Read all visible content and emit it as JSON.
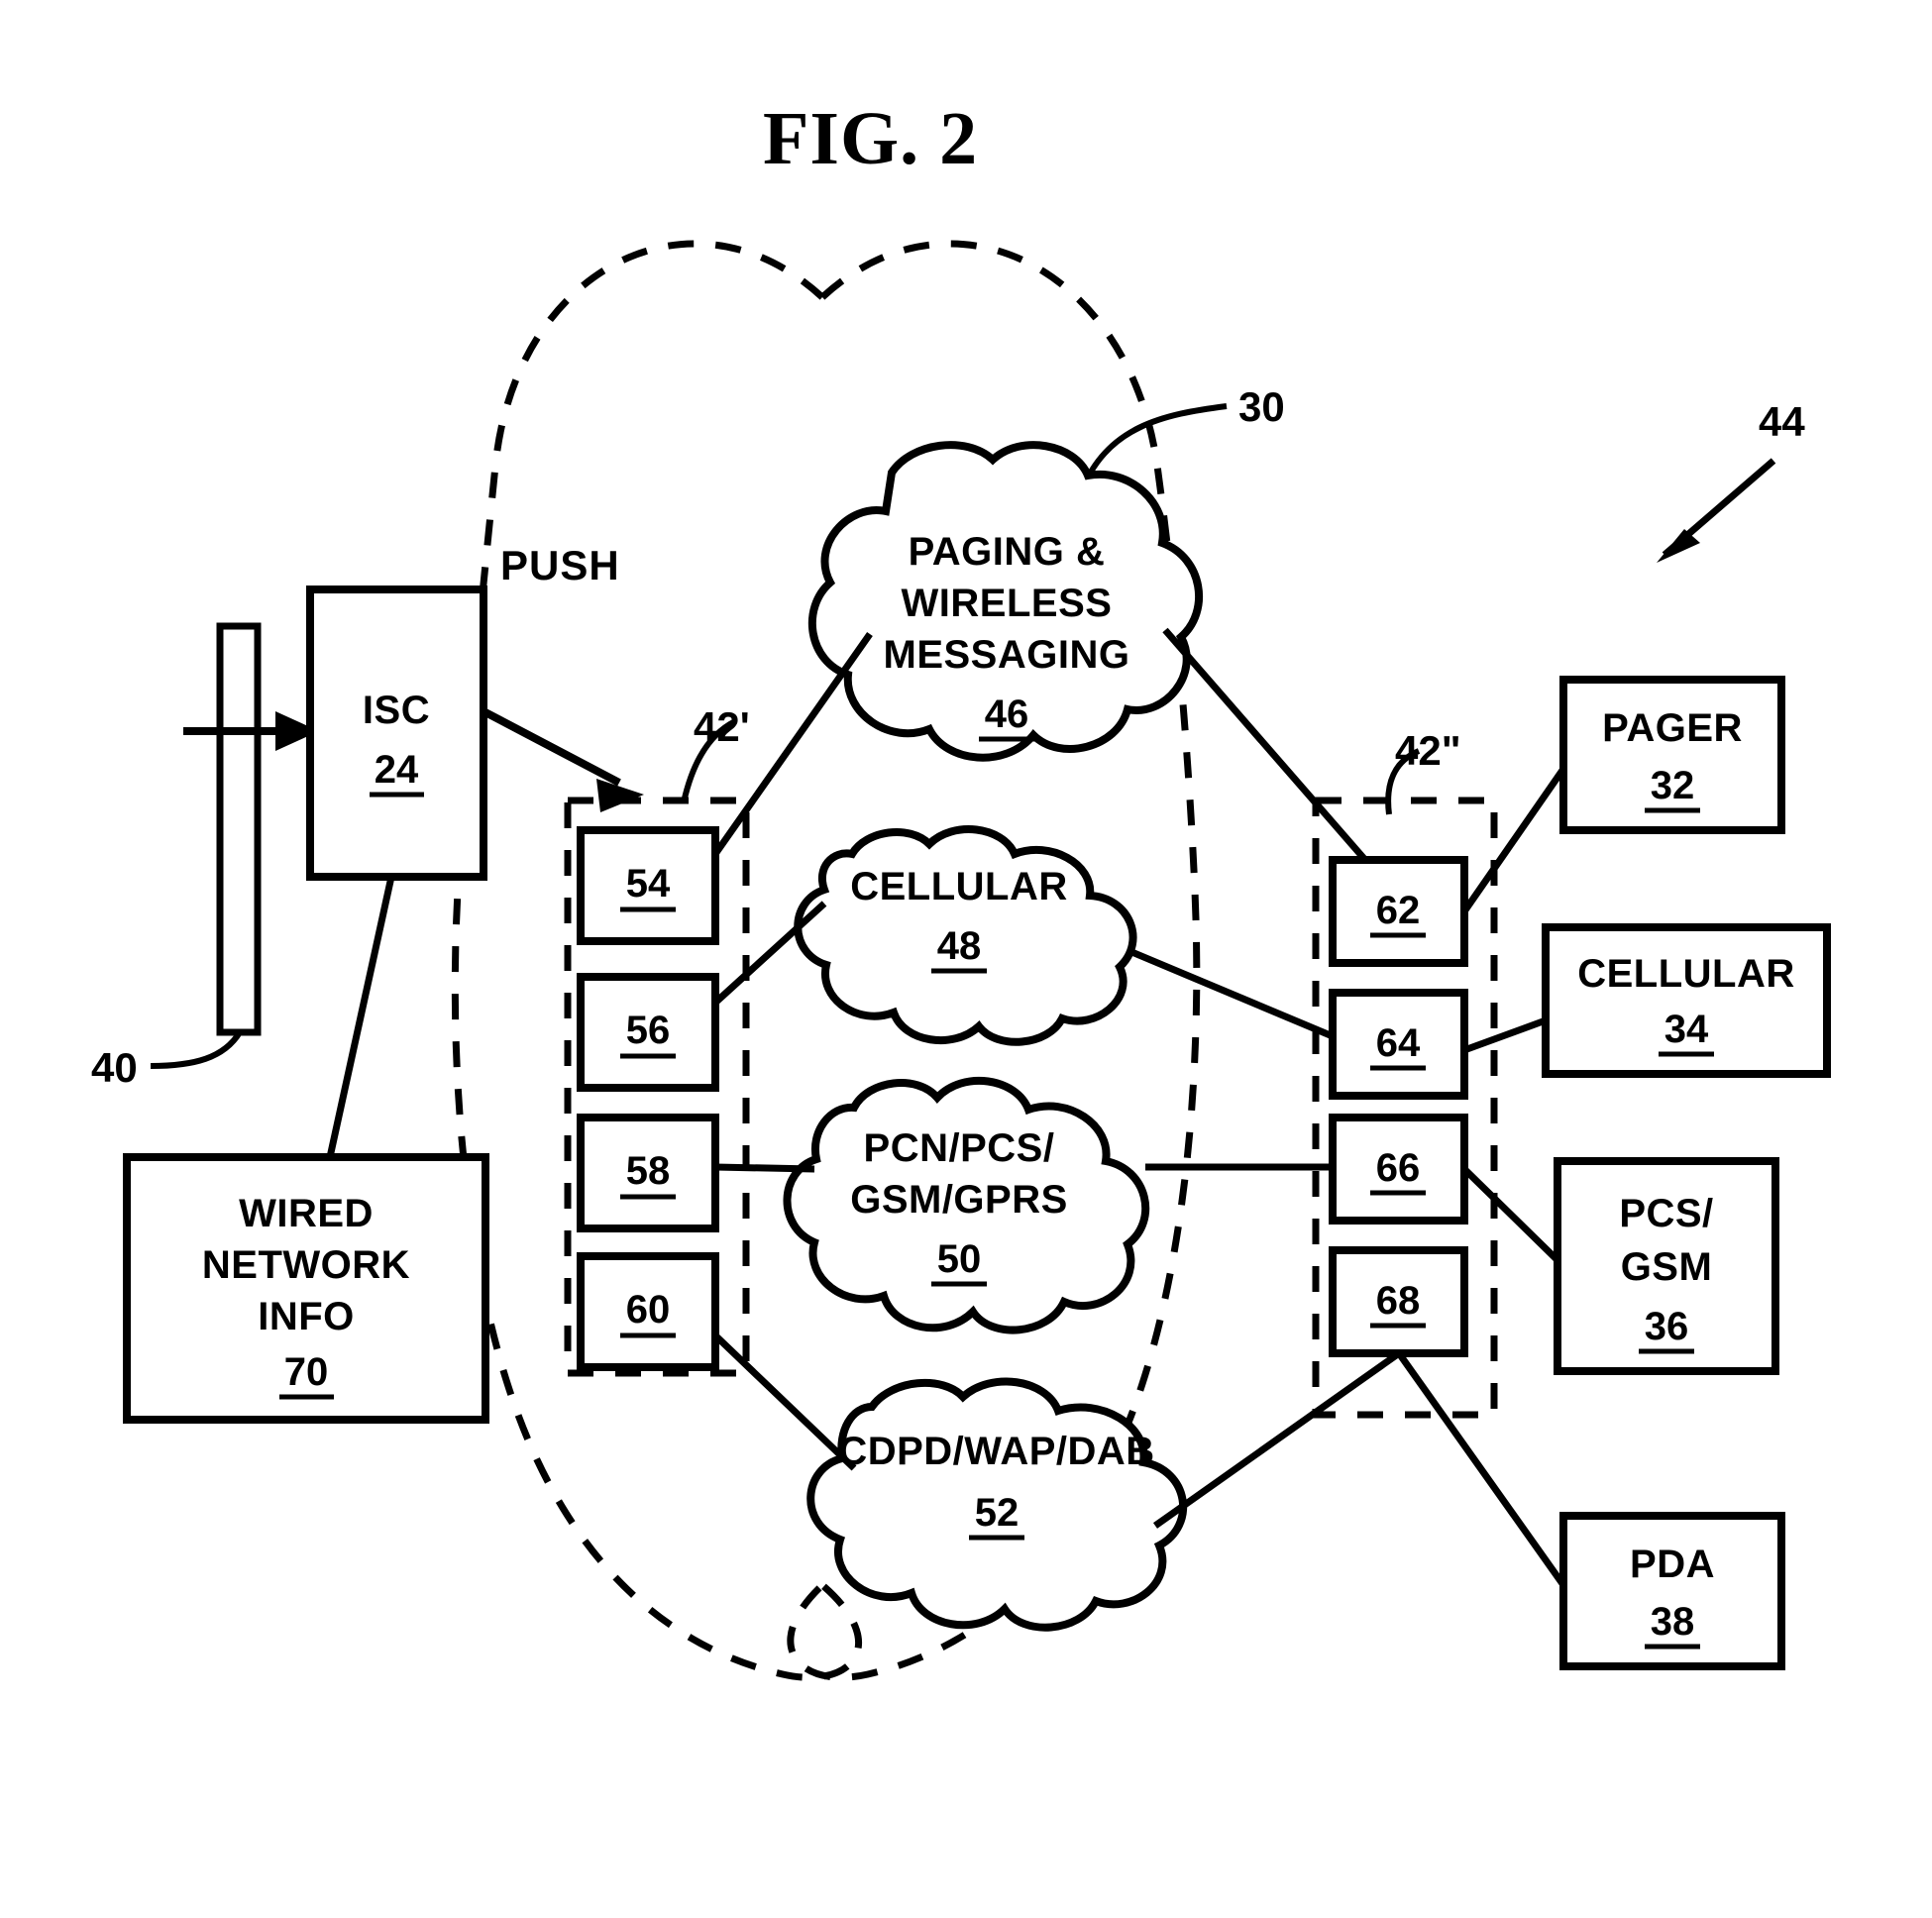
{
  "figure": {
    "title": "FIG. 2",
    "push_label": "PUSH",
    "system_ref": "44",
    "network_cloud_ref": "30",
    "left_interface_group_ref": "42'",
    "right_interface_group_ref": "42\"",
    "input_stream_ref": "40"
  },
  "source_nodes": {
    "isc": {
      "name": "ISC",
      "ref": "24"
    },
    "wired_network_info": {
      "line1": "WIRED",
      "line2": "NETWORK",
      "line3": "INFO",
      "ref": "70"
    }
  },
  "left_interfaces": [
    {
      "ref": "54"
    },
    {
      "ref": "56"
    },
    {
      "ref": "58"
    },
    {
      "ref": "60"
    }
  ],
  "networks": [
    {
      "line1": "PAGING &",
      "line2": "WIRELESS",
      "line3": "MESSAGING",
      "ref": "46"
    },
    {
      "line1": "CELLULAR",
      "line2": "",
      "line3": "",
      "ref": "48"
    },
    {
      "line1": "PCN/PCS/",
      "line2": "GSM/GPRS",
      "line3": "",
      "ref": "50"
    },
    {
      "line1": "CDPD/WAP/DAB",
      "line2": "",
      "line3": "",
      "ref": "52"
    }
  ],
  "right_interfaces": [
    {
      "ref": "62"
    },
    {
      "ref": "64"
    },
    {
      "ref": "66"
    },
    {
      "ref": "68"
    }
  ],
  "devices": [
    {
      "line1": "PAGER",
      "line2": "",
      "ref": "32"
    },
    {
      "line1": "CELLULAR",
      "line2": "",
      "ref": "34"
    },
    {
      "line1": "PCS/",
      "line2": "GSM",
      "ref": "36"
    },
    {
      "line1": "PDA",
      "line2": "",
      "ref": "38"
    }
  ],
  "colors": {
    "ink": "#000000",
    "paper": "#ffffff"
  }
}
